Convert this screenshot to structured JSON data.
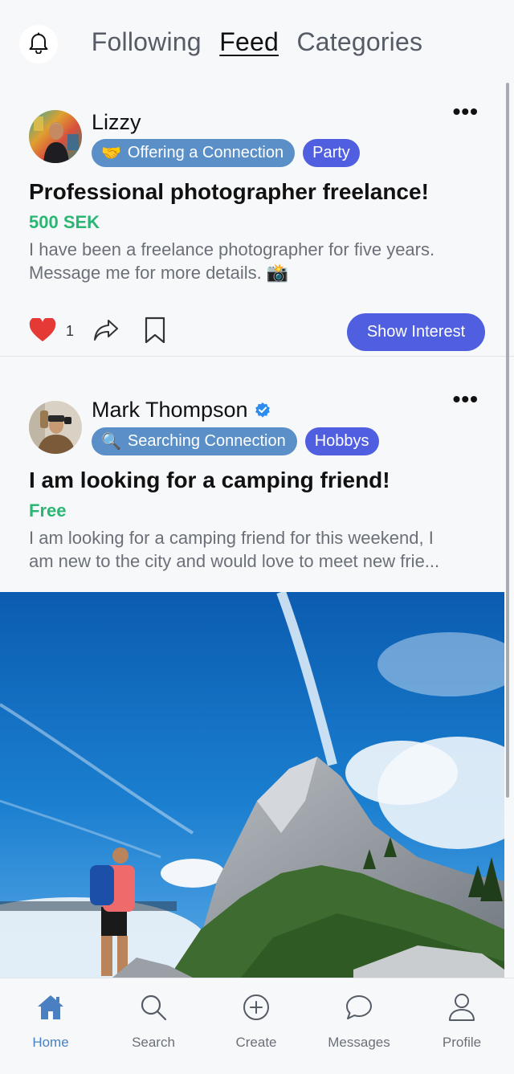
{
  "header": {
    "tabs": [
      {
        "label": "Following",
        "active": false
      },
      {
        "label": "Feed",
        "active": true
      },
      {
        "label": "Categories",
        "active": false
      }
    ]
  },
  "posts": [
    {
      "author": "Lizzy",
      "verified": false,
      "connection_badge": {
        "emoji": "🤝",
        "label": "Offering a Connection"
      },
      "category": "Party",
      "title": "Professional photographer freelance!",
      "price": "500 SEK",
      "description_lines": [
        "I have been a freelance photographer for five years.",
        "Message me for more details. 📸"
      ],
      "like_count": "1",
      "action_label": "Show Interest"
    },
    {
      "author": "Mark Thompson",
      "verified": true,
      "connection_badge": {
        "emoji": "🔍",
        "label": "Searching Connection"
      },
      "category": "Hobbys",
      "title": "I am looking for a camping friend!",
      "price": "Free",
      "description_lines": [
        "I am looking for a camping friend for this weekend, I",
        "am new to the city and would love to meet new frie..."
      ]
    }
  ],
  "bottom_nav": [
    {
      "label": "Home",
      "icon": "home-icon",
      "active": true
    },
    {
      "label": "Search",
      "icon": "search-icon",
      "active": false
    },
    {
      "label": "Create",
      "icon": "plus-circle-icon",
      "active": false
    },
    {
      "label": "Messages",
      "icon": "chat-bubble-icon",
      "active": false
    },
    {
      "label": "Profile",
      "icon": "person-icon",
      "active": false
    }
  ],
  "colors": {
    "accent": "#4f5fe0",
    "connection_badge": "#5b8fc7",
    "price": "#2bb673",
    "nav_active": "#4a7fc1",
    "heart": "#e53935"
  }
}
